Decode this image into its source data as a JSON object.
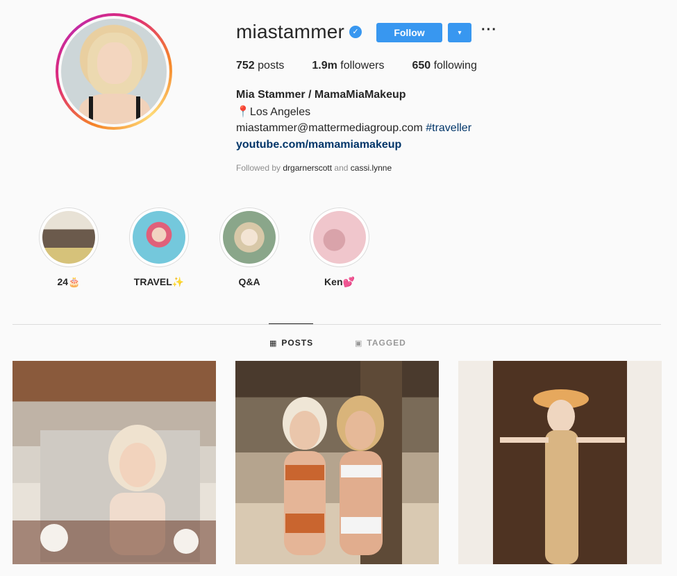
{
  "profile": {
    "username": "miastammer",
    "verified_icon": "verified-badge-icon",
    "follow_label": "Follow",
    "dropdown_icon": "▾",
    "more_icon": "···",
    "stats": {
      "posts_count": "752",
      "posts_label": " posts",
      "followers_count": "1.9m",
      "followers_label": " followers",
      "following_count": "650",
      "following_label": " following"
    },
    "full_name": "Mia Stammer / MamaMiaMakeup",
    "location_pin": "📍",
    "location": "Los Angeles",
    "email": "miastammer@mattermediagroup.com ",
    "hashtag": "#traveller",
    "website": "youtube.com/mamamiamakeup",
    "followed_by_prefix": "Followed by ",
    "followed_by_1": "drgarnerscott",
    "followed_by_and": " and ",
    "followed_by_2": "cassi.lynne"
  },
  "highlights": [
    {
      "label": "24🎂"
    },
    {
      "label": "TRAVEL✨"
    },
    {
      "label": "Q&A"
    },
    {
      "label": "Ken💕"
    }
  ],
  "tabs": {
    "posts": "POSTS",
    "tagged": "TAGGED"
  },
  "colors": {
    "accent": "#3897f0",
    "link": "#003569",
    "muted": "#8e8e8e",
    "background": "#fafafa"
  }
}
